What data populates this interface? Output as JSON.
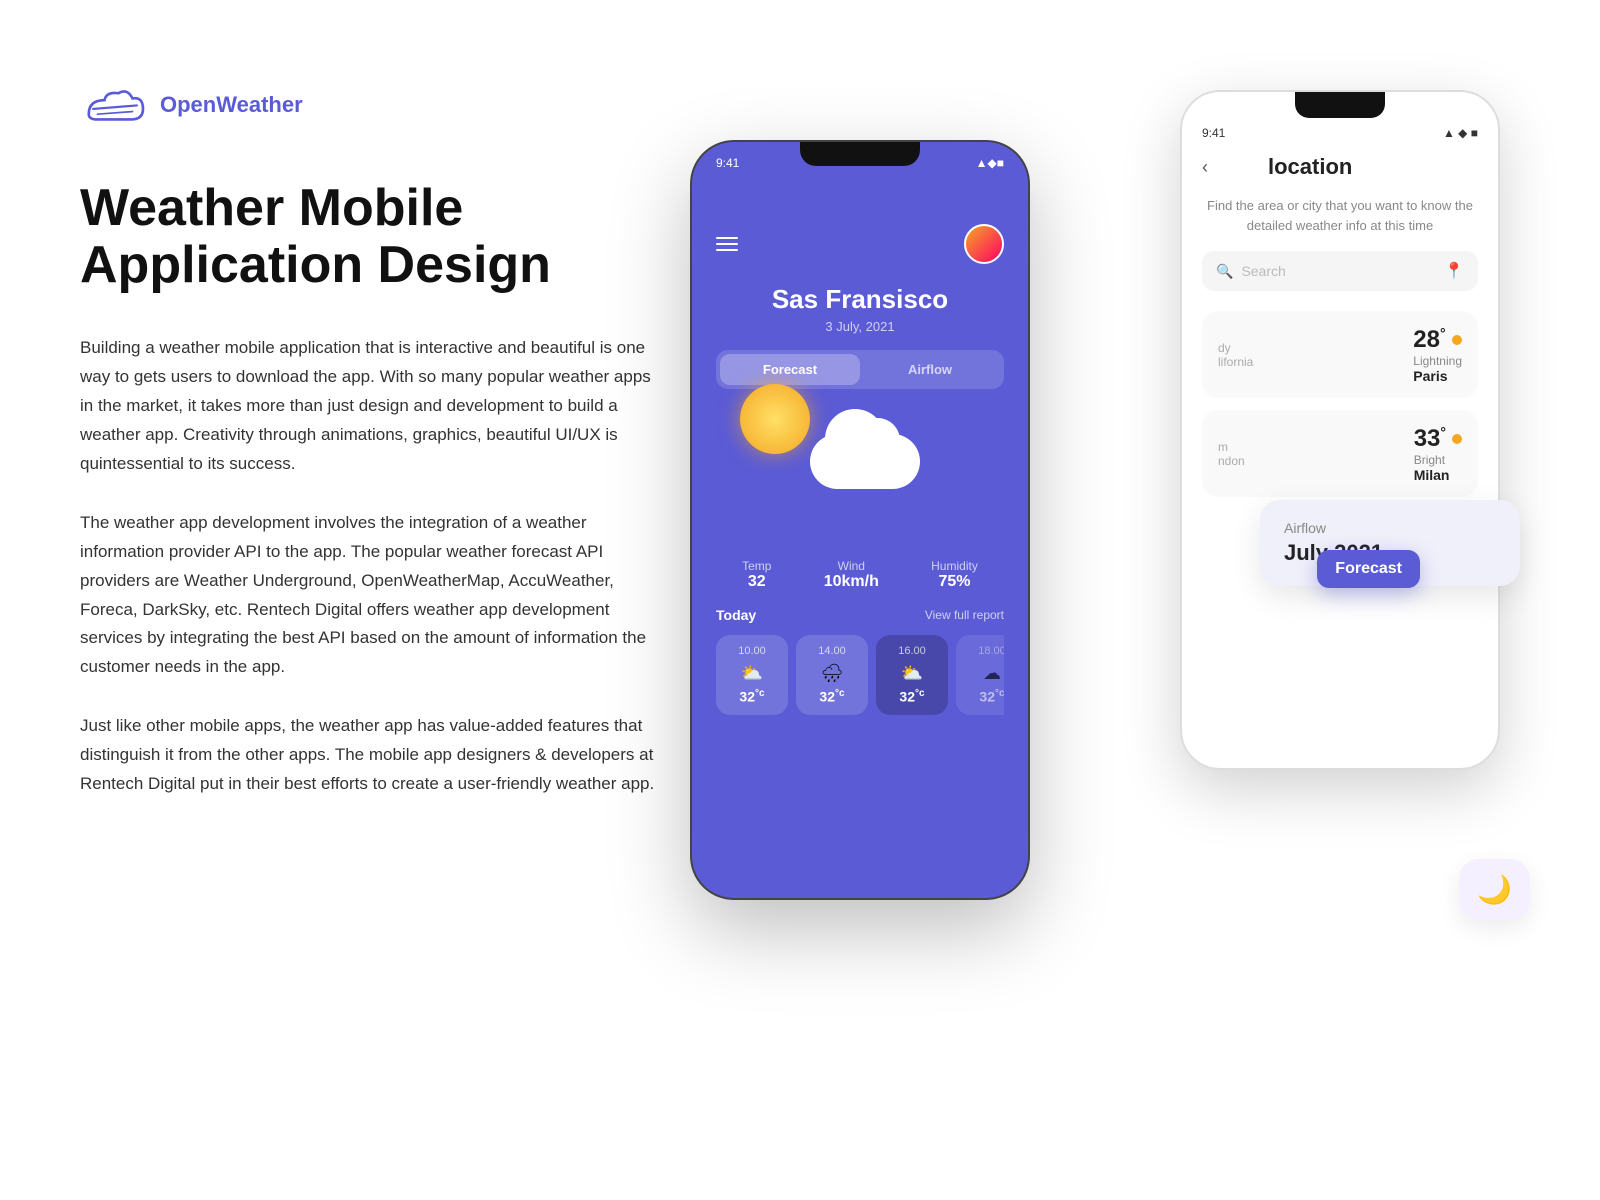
{
  "logo": {
    "text": "OpenWeather"
  },
  "headline": {
    "line1": "Weather Mobile",
    "line2": "Application Design"
  },
  "paragraphs": [
    "Building a weather mobile application that is interactive and beautiful is one way to gets users to download the app. With so many popular weather apps in the market, it takes more than just design and development to build a weather app. Creativity through animations, graphics, beautiful UI/UX is quintessential to its success.",
    "The weather app development involves the integration of a weather information provider API to the app. The popular weather forecast API providers are Weather Underground, OpenWeatherMap, AccuWeather, Foreca, DarkSky, etc. Rentech Digital offers weather app development services by integrating the best API based on the amount of information the customer needs in the app.",
    "Just like other mobile apps, the weather app has value-added features that distinguish it from the other apps. The mobile app designers & developers at Rentech Digital put in their best efforts to create a user-friendly weather app."
  ],
  "back_phone": {
    "status_left": "9:41",
    "title": "location",
    "subtitle": "Find the area or city that you want to know the detailed weather info at this time",
    "search_placeholder": "Search",
    "cities": [
      {
        "name": "Paris",
        "region": "dy",
        "country": "lifornia",
        "temp": "28",
        "condition": "Lightning"
      },
      {
        "name": "Milan",
        "region": "m",
        "country": "ndon",
        "temp": "33",
        "condition": "Bright"
      }
    ]
  },
  "front_phone": {
    "status_time": "9:41",
    "city": "Sas Fransisco",
    "date": "3 July, 2021",
    "tabs": [
      "Forecast",
      "Airflow"
    ],
    "active_tab": "Forecast",
    "weather_icon": "partly-cloudy",
    "stats": [
      {
        "label": "Temp",
        "value": "32"
      },
      {
        "label": "Wind",
        "value": "10km/h"
      },
      {
        "label": "Humidity",
        "value": "75%"
      }
    ],
    "today_label": "Today",
    "view_full": "View full report",
    "hourly": [
      {
        "time": "10.00",
        "temp": "32",
        "icon": "⛅"
      },
      {
        "time": "14.00",
        "temp": "32",
        "icon": "🌧"
      },
      {
        "time": "16.00",
        "temp": "32",
        "icon": "⛅",
        "selected": true
      },
      {
        "time": "18.00",
        "temp": "32",
        "icon": "☁"
      }
    ]
  },
  "airflow": {
    "month": "July 2021",
    "label": "Airflow",
    "sub_label": "Forecast"
  },
  "moon": {
    "icon": "🌙"
  },
  "colors": {
    "primary": "#5b5bd6",
    "accent": "#f5a623",
    "text_dark": "#111",
    "text_body": "#333",
    "text_muted": "#888"
  }
}
